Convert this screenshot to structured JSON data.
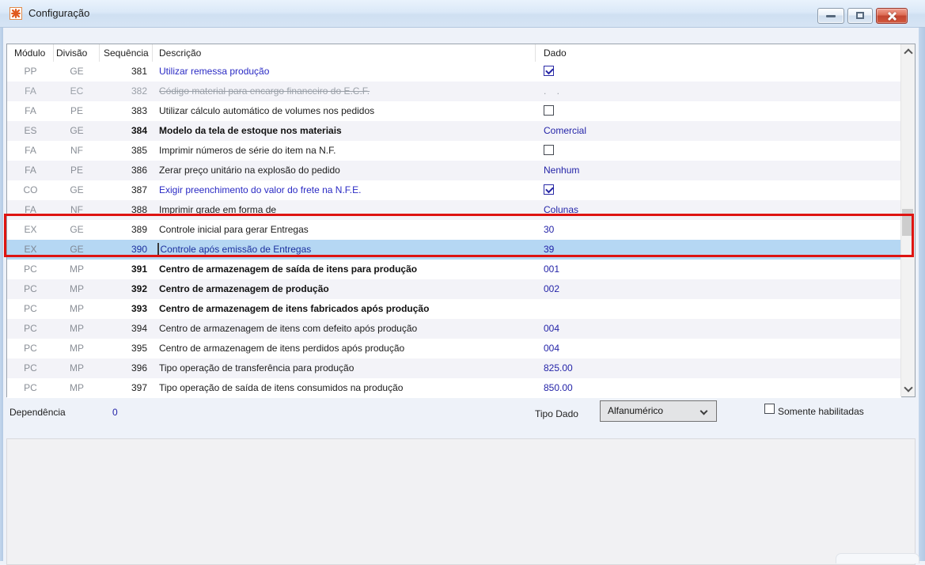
{
  "window": {
    "title": "Configuração",
    "controls": {
      "minimize": "minimize",
      "maximize": "maximize",
      "close": "close"
    }
  },
  "table": {
    "columns": [
      "Módulo",
      "Divisão",
      "Sequência",
      "Descrição",
      "Dado"
    ],
    "rows": [
      {
        "modulo": "PP",
        "divisao": "GE",
        "seq": "381",
        "desc": "Utilizar remessa produção",
        "style": "link",
        "dado": {
          "type": "checkbox",
          "checked": true
        }
      },
      {
        "modulo": "FA",
        "divisao": "EC",
        "seq": "382",
        "desc": "Código material para encargo financeiro do E.C.F.",
        "style": "disabled",
        "dado": {
          "type": "text",
          "value": ". ."
        }
      },
      {
        "modulo": "FA",
        "divisao": "PE",
        "seq": "383",
        "desc": "Utilizar cálculo automático de volumes nos pedidos",
        "style": "normal",
        "dado": {
          "type": "checkbox",
          "checked": false
        }
      },
      {
        "modulo": "ES",
        "divisao": "GE",
        "seq": "384",
        "desc": "Modelo da tela de estoque nos materiais",
        "style": "bold",
        "dado": {
          "type": "text",
          "value": "Comercial"
        }
      },
      {
        "modulo": "FA",
        "divisao": "NF",
        "seq": "385",
        "desc": "Imprimir números de série do item na N.F.",
        "style": "normal",
        "dado": {
          "type": "checkbox",
          "checked": false
        }
      },
      {
        "modulo": "FA",
        "divisao": "PE",
        "seq": "386",
        "desc": "Zerar preço unitário na explosão do pedido",
        "style": "normal",
        "dado": {
          "type": "text",
          "value": "Nenhum"
        }
      },
      {
        "modulo": "CO",
        "divisao": "GE",
        "seq": "387",
        "desc": "Exigir preenchimento do valor do frete na N.F.E.",
        "style": "link",
        "dado": {
          "type": "checkbox",
          "checked": true
        }
      },
      {
        "modulo": "FA",
        "divisao": "NF",
        "seq": "388",
        "desc": "Imprimir grade em forma de",
        "style": "normal",
        "dado": {
          "type": "text",
          "value": "Colunas"
        }
      },
      {
        "modulo": "EX",
        "divisao": "GE",
        "seq": "389",
        "desc": "Controle inicial para gerar Entregas",
        "style": "normal",
        "dado": {
          "type": "text",
          "value": "30"
        }
      },
      {
        "modulo": "EX",
        "divisao": "GE",
        "seq": "390",
        "desc": "Controle após emissão de Entregas",
        "style": "normal",
        "selected": true,
        "caret": true,
        "dado": {
          "type": "text",
          "value": "39"
        }
      },
      {
        "modulo": "PC",
        "divisao": "MP",
        "seq": "391",
        "desc": "Centro de armazenagem de saída de itens para produção",
        "style": "bold",
        "dado": {
          "type": "text",
          "value": "001"
        }
      },
      {
        "modulo": "PC",
        "divisao": "MP",
        "seq": "392",
        "desc": "Centro de armazenagem de produção",
        "style": "bold",
        "dado": {
          "type": "text",
          "value": "002"
        }
      },
      {
        "modulo": "PC",
        "divisao": "MP",
        "seq": "393",
        "desc": "Centro de armazenagem de itens fabricados após produção",
        "style": "bold",
        "dado": {
          "type": "text",
          "value": ""
        }
      },
      {
        "modulo": "PC",
        "divisao": "MP",
        "seq": "394",
        "desc": "Centro de armazenagem de itens com defeito após produção",
        "style": "normal",
        "dado": {
          "type": "text",
          "value": "004"
        }
      },
      {
        "modulo": "PC",
        "divisao": "MP",
        "seq": "395",
        "desc": "Centro de armazenagem de itens perdidos após produção",
        "style": "normal",
        "dado": {
          "type": "text",
          "value": "004"
        }
      },
      {
        "modulo": "PC",
        "divisao": "MP",
        "seq": "396",
        "desc": "Tipo operação de transferência para produção",
        "style": "normal",
        "dado": {
          "type": "text",
          "value": "825.00"
        }
      },
      {
        "modulo": "PC",
        "divisao": "MP",
        "seq": "397",
        "desc": "Tipo operação de saída de itens consumidos na produção",
        "style": "normal",
        "dado": {
          "type": "text",
          "value": "850.00"
        }
      }
    ],
    "highlighted_sequences": [
      "389",
      "390"
    ],
    "selected_sequence": "390"
  },
  "footer": {
    "dependencia_label": "Dependência",
    "dependencia_value": "0",
    "tipo_dado_label": "Tipo Dado",
    "tipo_dado_value": "Alfanumérico",
    "somente_habilitadas_label": "Somente habilitadas",
    "somente_habilitadas_checked": false
  },
  "colors": {
    "accent_blue_text": "#2a2ac4",
    "dado_value_blue": "#2424a8",
    "selected_row_bg": "#b5d7f3",
    "highlight_red": "#de1411",
    "disabled_gray": "#9aa0a8",
    "titlebar_blue": "#dbe9f8",
    "close_button_red": "#c24530"
  }
}
